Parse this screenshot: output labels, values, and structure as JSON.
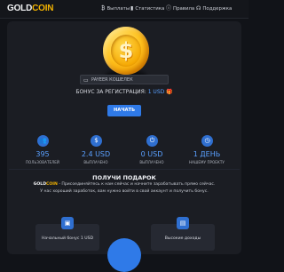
{
  "brand": {
    "part1": "GOLD",
    "part2": "COIN"
  },
  "nav": [
    {
      "icon": "bitcoin-icon",
      "glyph": "₿",
      "label": "Выплаты"
    },
    {
      "icon": "bar-chart-icon",
      "glyph": "▮",
      "label": "Статистика"
    },
    {
      "icon": "info-icon",
      "glyph": "ⓘ",
      "label": "Правила"
    },
    {
      "icon": "headset-icon",
      "glyph": "☊",
      "label": "Поддержка"
    }
  ],
  "wallet": {
    "icon": "wallet-icon",
    "placeholder": "PAYEER КОШЕЛЕК"
  },
  "bonus": {
    "prefix": "БОНУС ЗА РЕГИСТРАЦИЯ:",
    "value": "1 USD",
    "suffix": "🎁"
  },
  "start_button": "НАЧАТЬ",
  "stats": [
    {
      "icon": "users-icon",
      "glyph": "👥",
      "value": "395",
      "label": "ПОЛЬЗОВАТЕЛЕЙ"
    },
    {
      "icon": "money-icon",
      "glyph": "$",
      "value": "2.4 USD",
      "label": "ВЫПЛАЧЕНО"
    },
    {
      "icon": "power-icon",
      "glyph": "⏻",
      "value": "0 USD",
      "label": "ВЫПЛАЧЕНО"
    },
    {
      "icon": "clock-icon",
      "glyph": "◷",
      "value": "1 ДЕНЬ",
      "label": "НАШЕМУ ПРОЕКТУ"
    }
  ],
  "gift": {
    "title": "ПОЛУЧИ ПОДАРОК",
    "brand1": "GOLD",
    "brand2": "COIN",
    "line1": " - Присоединяйтесь к нам сейчас и начните зарабатывать прямо сейчас.",
    "line2": "У нас хороший заработок, вам нужно войти в свой аккаунт и получить бонус."
  },
  "tiers": [
    {
      "icon": "gift-box-icon",
      "glyph": "▣",
      "label": "Начальный бонус 1 USD"
    },
    {
      "icon": "chart-icon",
      "glyph": "▤",
      "label": "Высокие доходы"
    }
  ]
}
